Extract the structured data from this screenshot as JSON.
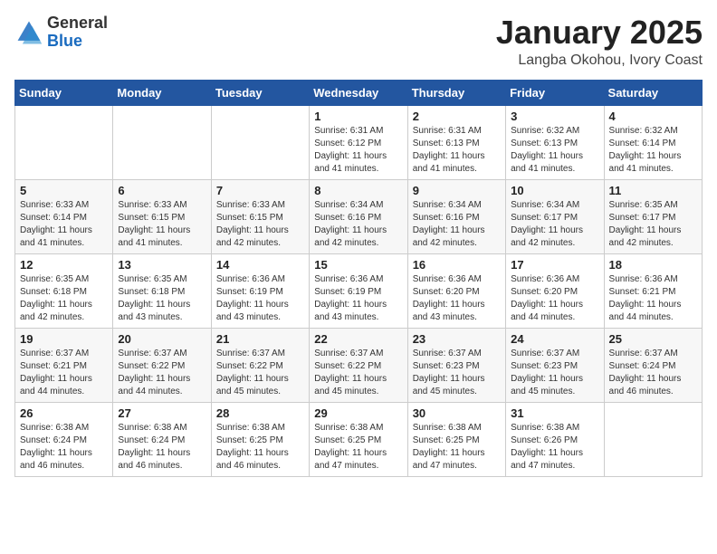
{
  "header": {
    "logo_general": "General",
    "logo_blue": "Blue",
    "month_year": "January 2025",
    "location": "Langba Okohou, Ivory Coast"
  },
  "weekdays": [
    "Sunday",
    "Monday",
    "Tuesday",
    "Wednesday",
    "Thursday",
    "Friday",
    "Saturday"
  ],
  "weeks": [
    [
      {
        "day": "",
        "info": ""
      },
      {
        "day": "",
        "info": ""
      },
      {
        "day": "",
        "info": ""
      },
      {
        "day": "1",
        "info": "Sunrise: 6:31 AM\nSunset: 6:12 PM\nDaylight: 11 hours\nand 41 minutes."
      },
      {
        "day": "2",
        "info": "Sunrise: 6:31 AM\nSunset: 6:13 PM\nDaylight: 11 hours\nand 41 minutes."
      },
      {
        "day": "3",
        "info": "Sunrise: 6:32 AM\nSunset: 6:13 PM\nDaylight: 11 hours\nand 41 minutes."
      },
      {
        "day": "4",
        "info": "Sunrise: 6:32 AM\nSunset: 6:14 PM\nDaylight: 11 hours\nand 41 minutes."
      }
    ],
    [
      {
        "day": "5",
        "info": "Sunrise: 6:33 AM\nSunset: 6:14 PM\nDaylight: 11 hours\nand 41 minutes."
      },
      {
        "day": "6",
        "info": "Sunrise: 6:33 AM\nSunset: 6:15 PM\nDaylight: 11 hours\nand 41 minutes."
      },
      {
        "day": "7",
        "info": "Sunrise: 6:33 AM\nSunset: 6:15 PM\nDaylight: 11 hours\nand 42 minutes."
      },
      {
        "day": "8",
        "info": "Sunrise: 6:34 AM\nSunset: 6:16 PM\nDaylight: 11 hours\nand 42 minutes."
      },
      {
        "day": "9",
        "info": "Sunrise: 6:34 AM\nSunset: 6:16 PM\nDaylight: 11 hours\nand 42 minutes."
      },
      {
        "day": "10",
        "info": "Sunrise: 6:34 AM\nSunset: 6:17 PM\nDaylight: 11 hours\nand 42 minutes."
      },
      {
        "day": "11",
        "info": "Sunrise: 6:35 AM\nSunset: 6:17 PM\nDaylight: 11 hours\nand 42 minutes."
      }
    ],
    [
      {
        "day": "12",
        "info": "Sunrise: 6:35 AM\nSunset: 6:18 PM\nDaylight: 11 hours\nand 42 minutes."
      },
      {
        "day": "13",
        "info": "Sunrise: 6:35 AM\nSunset: 6:18 PM\nDaylight: 11 hours\nand 43 minutes."
      },
      {
        "day": "14",
        "info": "Sunrise: 6:36 AM\nSunset: 6:19 PM\nDaylight: 11 hours\nand 43 minutes."
      },
      {
        "day": "15",
        "info": "Sunrise: 6:36 AM\nSunset: 6:19 PM\nDaylight: 11 hours\nand 43 minutes."
      },
      {
        "day": "16",
        "info": "Sunrise: 6:36 AM\nSunset: 6:20 PM\nDaylight: 11 hours\nand 43 minutes."
      },
      {
        "day": "17",
        "info": "Sunrise: 6:36 AM\nSunset: 6:20 PM\nDaylight: 11 hours\nand 44 minutes."
      },
      {
        "day": "18",
        "info": "Sunrise: 6:36 AM\nSunset: 6:21 PM\nDaylight: 11 hours\nand 44 minutes."
      }
    ],
    [
      {
        "day": "19",
        "info": "Sunrise: 6:37 AM\nSunset: 6:21 PM\nDaylight: 11 hours\nand 44 minutes."
      },
      {
        "day": "20",
        "info": "Sunrise: 6:37 AM\nSunset: 6:22 PM\nDaylight: 11 hours\nand 44 minutes."
      },
      {
        "day": "21",
        "info": "Sunrise: 6:37 AM\nSunset: 6:22 PM\nDaylight: 11 hours\nand 45 minutes."
      },
      {
        "day": "22",
        "info": "Sunrise: 6:37 AM\nSunset: 6:22 PM\nDaylight: 11 hours\nand 45 minutes."
      },
      {
        "day": "23",
        "info": "Sunrise: 6:37 AM\nSunset: 6:23 PM\nDaylight: 11 hours\nand 45 minutes."
      },
      {
        "day": "24",
        "info": "Sunrise: 6:37 AM\nSunset: 6:23 PM\nDaylight: 11 hours\nand 45 minutes."
      },
      {
        "day": "25",
        "info": "Sunrise: 6:37 AM\nSunset: 6:24 PM\nDaylight: 11 hours\nand 46 minutes."
      }
    ],
    [
      {
        "day": "26",
        "info": "Sunrise: 6:38 AM\nSunset: 6:24 PM\nDaylight: 11 hours\nand 46 minutes."
      },
      {
        "day": "27",
        "info": "Sunrise: 6:38 AM\nSunset: 6:24 PM\nDaylight: 11 hours\nand 46 minutes."
      },
      {
        "day": "28",
        "info": "Sunrise: 6:38 AM\nSunset: 6:25 PM\nDaylight: 11 hours\nand 46 minutes."
      },
      {
        "day": "29",
        "info": "Sunrise: 6:38 AM\nSunset: 6:25 PM\nDaylight: 11 hours\nand 47 minutes."
      },
      {
        "day": "30",
        "info": "Sunrise: 6:38 AM\nSunset: 6:25 PM\nDaylight: 11 hours\nand 47 minutes."
      },
      {
        "day": "31",
        "info": "Sunrise: 6:38 AM\nSunset: 6:26 PM\nDaylight: 11 hours\nand 47 minutes."
      },
      {
        "day": "",
        "info": ""
      }
    ]
  ]
}
